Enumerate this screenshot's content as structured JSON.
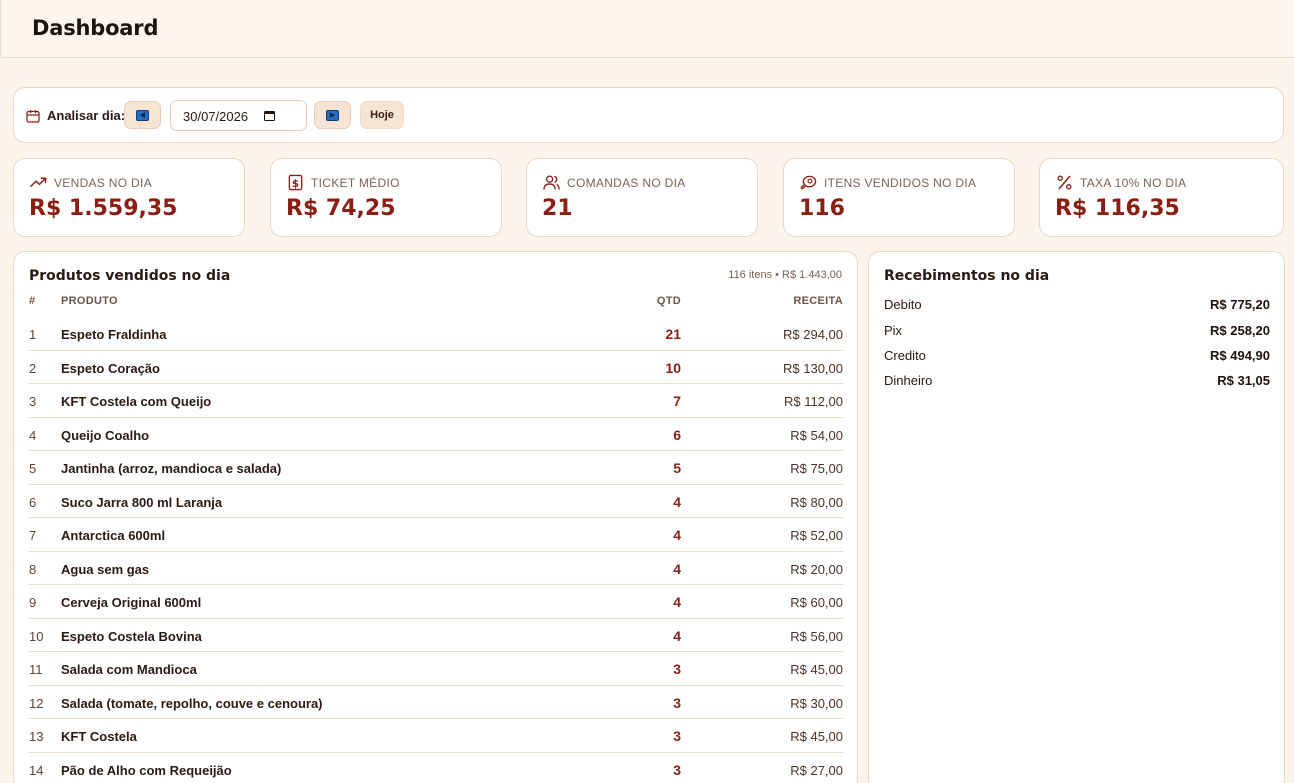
{
  "header": {
    "title": "Dashboard"
  },
  "datebar": {
    "label": "Analisar dia:",
    "date_value": "30/07/2026",
    "prev_symbol": "◀",
    "next_symbol": "▶",
    "today_label": "Hoje"
  },
  "stats": [
    {
      "icon": "trending-up-icon",
      "label": "VENDAS NO DIA",
      "value": "R$ 1.559,35"
    },
    {
      "icon": "receipt-dollar-icon",
      "label": "TICKET MÉDIO",
      "value": "R$ 74,25"
    },
    {
      "icon": "users-icon",
      "label": "COMANDAS NO DIA",
      "value": "21"
    },
    {
      "icon": "beef-icon",
      "label": "ITENS VENDIDOS NO DIA",
      "value": "116"
    },
    {
      "icon": "percent-icon",
      "label": "TAXA 10% NO DIA",
      "value": "R$ 116,35"
    }
  ],
  "products": {
    "title": "Produtos vendidos no dia",
    "summary": "116 itens • R$ 1.443,00",
    "columns": {
      "num": "#",
      "product": "PRODUTO",
      "qty": "QTD",
      "revenue": "RECEITA"
    },
    "rows": [
      {
        "num": "1",
        "product": "Espeto Fraldinha",
        "qty": "21",
        "revenue": "R$ 294,00"
      },
      {
        "num": "2",
        "product": "Espeto Coração",
        "qty": "10",
        "revenue": "R$ 130,00"
      },
      {
        "num": "3",
        "product": "KFT Costela com Queijo",
        "qty": "7",
        "revenue": "R$ 112,00"
      },
      {
        "num": "4",
        "product": "Queijo Coalho",
        "qty": "6",
        "revenue": "R$ 54,00"
      },
      {
        "num": "5",
        "product": "Jantinha (arroz, mandioca e salada)",
        "qty": "5",
        "revenue": "R$ 75,00"
      },
      {
        "num": "6",
        "product": "Suco Jarra 800 ml Laranja",
        "qty": "4",
        "revenue": "R$ 80,00"
      },
      {
        "num": "7",
        "product": "Antarctica 600ml",
        "qty": "4",
        "revenue": "R$ 52,00"
      },
      {
        "num": "8",
        "product": "Agua sem gas",
        "qty": "4",
        "revenue": "R$ 20,00"
      },
      {
        "num": "9",
        "product": "Cerveja Original 600ml",
        "qty": "4",
        "revenue": "R$ 60,00"
      },
      {
        "num": "10",
        "product": "Espeto Costela Bovina",
        "qty": "4",
        "revenue": "R$ 56,00"
      },
      {
        "num": "11",
        "product": "Salada com Mandioca",
        "qty": "3",
        "revenue": "R$ 45,00"
      },
      {
        "num": "12",
        "product": "Salada (tomate, repolho, couve e cenoura)",
        "qty": "3",
        "revenue": "R$ 30,00"
      },
      {
        "num": "13",
        "product": "KFT Costela",
        "qty": "3",
        "revenue": "R$ 45,00"
      },
      {
        "num": "14",
        "product": "Pão de Alho com Requeijão",
        "qty": "3",
        "revenue": "R$ 27,00"
      }
    ]
  },
  "receipts": {
    "title": "Recebimentos no dia",
    "items": [
      {
        "method": "Debito",
        "amount": "R$ 775,20"
      },
      {
        "method": "Pix",
        "amount": "R$ 258,20"
      },
      {
        "method": "Credito",
        "amount": "R$ 494,90"
      },
      {
        "method": "Dinheiro",
        "amount": "R$ 31,05"
      }
    ]
  },
  "colors": {
    "accent": "#8b1d12",
    "background": "#fcf3ea",
    "button_bg": "#f8e4d3"
  }
}
